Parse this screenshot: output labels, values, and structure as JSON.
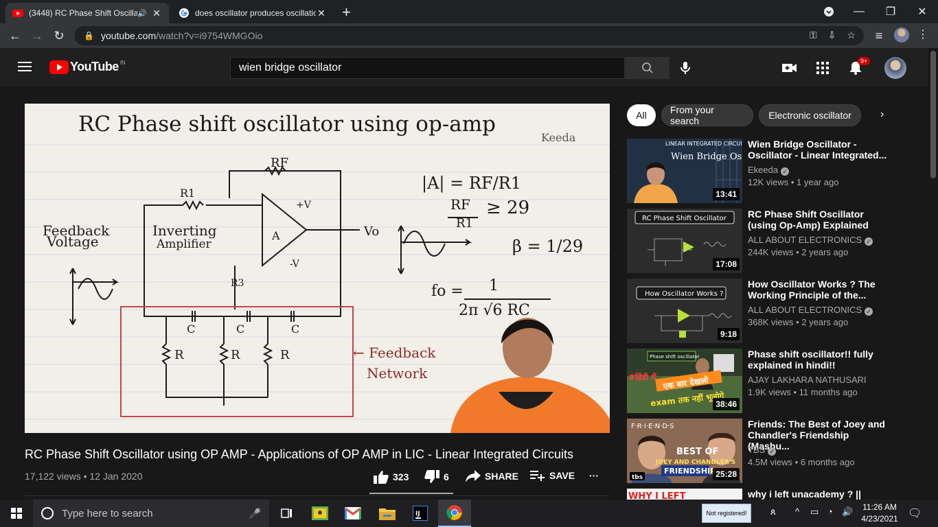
{
  "browser": {
    "tabs": [
      {
        "title": "(3448) RC Phase Shift Oscilla",
        "active": true,
        "favicon": "youtube-icon",
        "audio": true
      },
      {
        "title": "does oscillator produces oscillatio",
        "active": false,
        "favicon": "google-icon"
      }
    ],
    "url_domain": "youtube.com",
    "url_path": "/watch?v=i9754WMGOio"
  },
  "youtube": {
    "logo_text": "YouTube",
    "region": "IN",
    "search_query": "wien bridge oscillator",
    "notification_count": "9+"
  },
  "video": {
    "whiteboard": {
      "heading": "RC Phase shift oscillator using op-amp",
      "watermark": "Keeda",
      "rf": "RF",
      "r1": "R1",
      "r3": "R3",
      "plus_v": "+V",
      "minus_v": "-V",
      "amp": "A",
      "vo": "Vo",
      "feedback_voltage_1": "Feedback",
      "feedback_voltage_2": "Voltage",
      "inverting_1": "Inverting",
      "inverting_2": "Amplifier",
      "eq1": "|A| = RF/R1",
      "eq2_num": "RF",
      "eq2_den": "R1",
      "eq2_rhs": "≥ 29",
      "eq3": "β = 1/29",
      "eq4_lhs": "fo =",
      "eq4_num": "1",
      "eq4_den": "2π √6 RC",
      "c": "C",
      "r": "R",
      "feedback_network_1": "← Feedback",
      "feedback_network_2": "Network"
    },
    "title": "RC Phase Shift Oscillator using OP AMP - Applications of OP AMP in LIC - Linear Integrated Circuits",
    "views": "17,122 views",
    "date": "12 Jan 2020",
    "likes": "323",
    "dislikes": "6",
    "share_label": "SHARE",
    "save_label": "SAVE"
  },
  "chips": [
    "All",
    "From your search",
    "Electronic oscillator"
  ],
  "recommendations": [
    {
      "title": "Wien Bridge Oscillator - Oscillator - Linear Integrated...",
      "channel": "Ekeeda",
      "verified": true,
      "views": "12K views",
      "age": "1 year ago",
      "duration": "13:41",
      "thumb_text_1": "LINEAR INTEGRATED CIRCUITS",
      "thumb_text_2": "Wien Bridge Oscillator"
    },
    {
      "title": "RC Phase Shift Oscillator (using Op-Amp) Explained",
      "channel": "ALL ABOUT ELECTRONICS",
      "verified": true,
      "views": "244K views",
      "age": "2 years ago",
      "duration": "17:08",
      "thumb_text_1": "RC Phase Shift Oscillator"
    },
    {
      "title": "How Oscillator Works ? The Working Principle of the...",
      "channel": "ALL ABOUT ELECTRONICS",
      "verified": true,
      "views": "368K views",
      "age": "2 years ago",
      "duration": "9:18",
      "thumb_text_1": "How Oscillator Works ?"
    },
    {
      "title": "Phase shift oscillator!! fully explained in hindi!!",
      "channel": "AJAY LAKHARA NATHUSARI",
      "verified": false,
      "views": "1.9K views",
      "age": "11 months ago",
      "duration": "38:46",
      "thumb_text_1": "Phase shift oscillator",
      "thumb_text_2": "#हिंदी में",
      "thumb_text_3": "एक बार देखलो",
      "thumb_text_4": "exam तक नहीं भूलोगे"
    },
    {
      "title": "Friends: The Best of Joey and Chandler's Friendship (Mashu...",
      "channel": "TBS",
      "verified": true,
      "views": "4.5M views",
      "age": "6 months ago",
      "duration": "25:28",
      "thumb_text_1": "F·R·I·E·N·D·S",
      "thumb_text_2": "BEST OF",
      "thumb_text_3": "JOEY AND CHANDLER'S",
      "thumb_text_4": "FRIENDSHIP",
      "thumb_text_5": "tbs"
    },
    {
      "title": "why i left unacademy ? ||",
      "thumb_text_1": "WHY I LEFT"
    }
  ],
  "taskbar": {
    "search_placeholder": "Type here to search",
    "not_registered": "Not registered!",
    "time": "11:26 AM",
    "date": "4/23/2021"
  }
}
